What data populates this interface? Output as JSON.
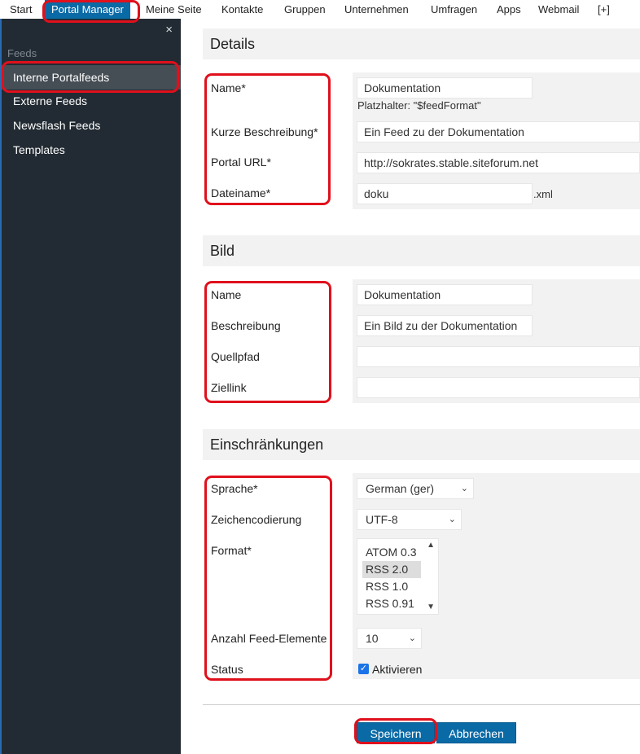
{
  "topnav": {
    "items": [
      "Start",
      "Portal Manager",
      "Meine Seite",
      "Kontakte",
      "Gruppen",
      "Unternehmen",
      "Umfragen",
      "Apps",
      "Webmail",
      "[+]"
    ]
  },
  "sidebar": {
    "close_label": "×",
    "heading": "Feeds",
    "items": [
      "Interne Portalfeeds",
      "Externe Feeds",
      "Newsflash Feeds",
      "Templates"
    ]
  },
  "details": {
    "title": "Details",
    "name_label": "Name*",
    "name_value": "Dokumentation",
    "name_hint": "Platzhalter: \"$feedFormat\"",
    "desc_label": "Kurze Beschreibung*",
    "desc_value": "Ein Feed zu der Dokumentation",
    "url_label": "Portal URL*",
    "url_value": "http://sokrates.stable.siteforum.net",
    "file_label": "Dateiname*",
    "file_value": "doku",
    "file_suffix": ".xml"
  },
  "bild": {
    "title": "Bild",
    "name_label": "Name",
    "name_value": "Dokumentation",
    "desc_label": "Beschreibung",
    "desc_value": "Ein Bild zu der Dokumentation",
    "src_label": "Quellpfad",
    "src_value": "",
    "link_label": "Ziellink",
    "link_value": ""
  },
  "restrictions": {
    "title": "Einschränkungen",
    "lang_label": "Sprache*",
    "lang_value": "German (ger)",
    "enc_label": "Zeichencodierung",
    "enc_value": "UTF-8",
    "format_label": "Format*",
    "format_options": [
      "ATOM 0.3",
      "RSS 2.0",
      "RSS 1.0",
      "RSS 0.91"
    ],
    "format_selected": "RSS 2.0",
    "count_label": "Anzahl Feed-Elemente",
    "count_value": "10",
    "status_label": "Status",
    "status_checkbox_label": "Aktivieren",
    "status_checked": true
  },
  "actions": {
    "save_label": "Speichern",
    "cancel_label": "Abbrechen"
  },
  "colors": {
    "accent": "#0a6aa6",
    "highlight": "#e0101c",
    "sidebar_bg": "#222b33"
  }
}
